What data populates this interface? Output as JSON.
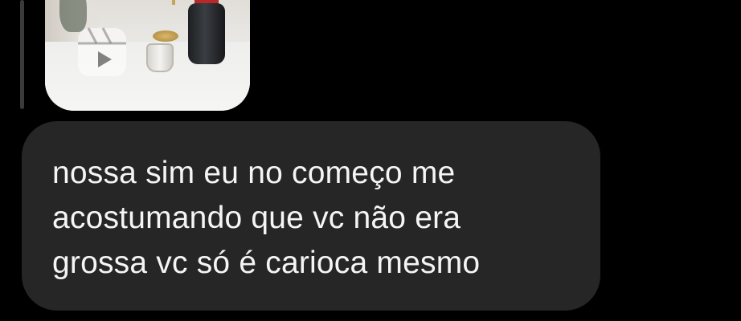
{
  "message": {
    "text": "nossa sim eu no começo me\nacostumando que vc não era\ngrossa vc só é carioca mesmo"
  },
  "shared_reel": {
    "icon": "reels-icon",
    "thumbnail": "product-photo"
  },
  "colors": {
    "background": "#000000",
    "bubble": "#262626",
    "text": "#f5f5f5"
  }
}
